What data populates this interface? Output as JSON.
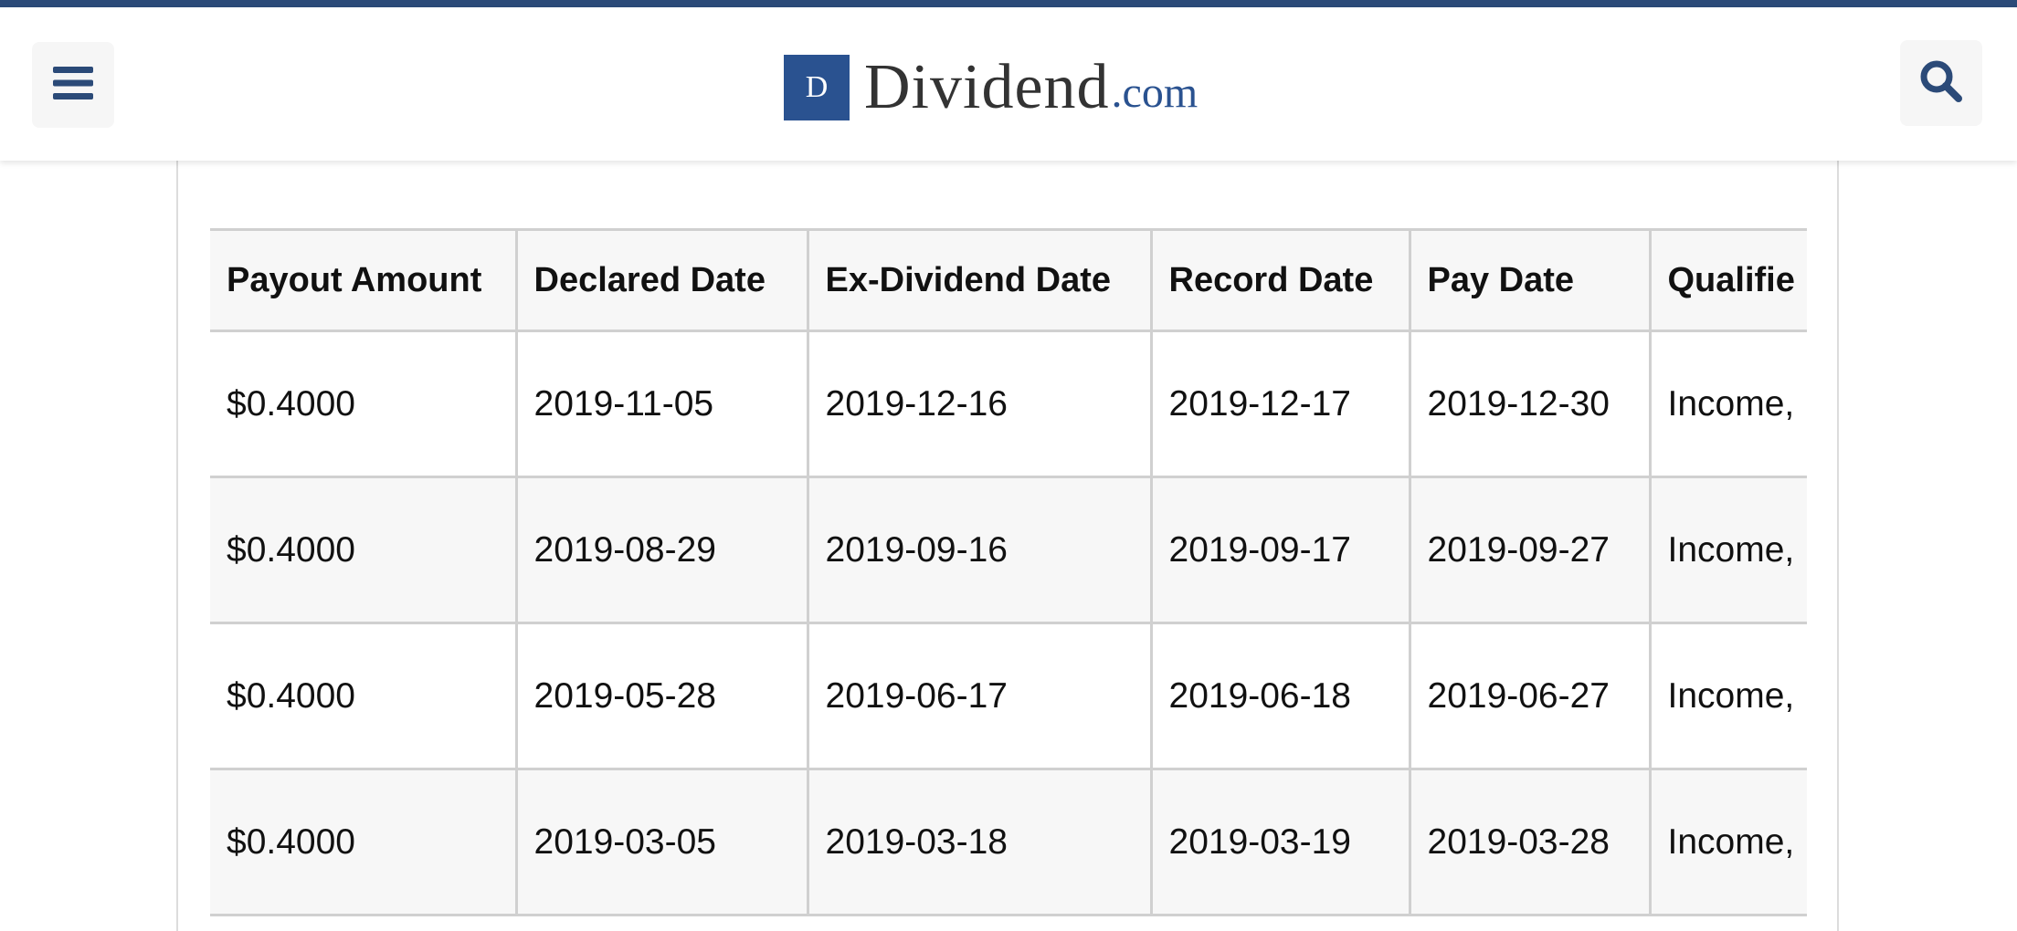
{
  "header": {
    "logo_letter": "D",
    "logo_word": "Dividend",
    "logo_tld": ".com",
    "menu_icon": "hamburger-menu-icon",
    "search_icon": "search-icon",
    "brand_color": "#2a5290",
    "top_bar_color": "#2b4a78"
  },
  "table": {
    "columns": [
      "Payout Amount",
      "Declared Date",
      "Ex-Dividend Date",
      "Record Date",
      "Pay Date",
      "Qualifie"
    ],
    "rows": [
      [
        "$0.4000",
        "2019-11-05",
        "2019-12-16",
        "2019-12-17",
        "2019-12-30",
        "Income,"
      ],
      [
        "$0.4000",
        "2019-08-29",
        "2019-09-16",
        "2019-09-17",
        "2019-09-27",
        "Income,"
      ],
      [
        "$0.4000",
        "2019-05-28",
        "2019-06-17",
        "2019-06-18",
        "2019-06-27",
        "Income,"
      ],
      [
        "$0.4000",
        "2019-03-05",
        "2019-03-18",
        "2019-03-19",
        "2019-03-28",
        "Income,"
      ]
    ]
  }
}
